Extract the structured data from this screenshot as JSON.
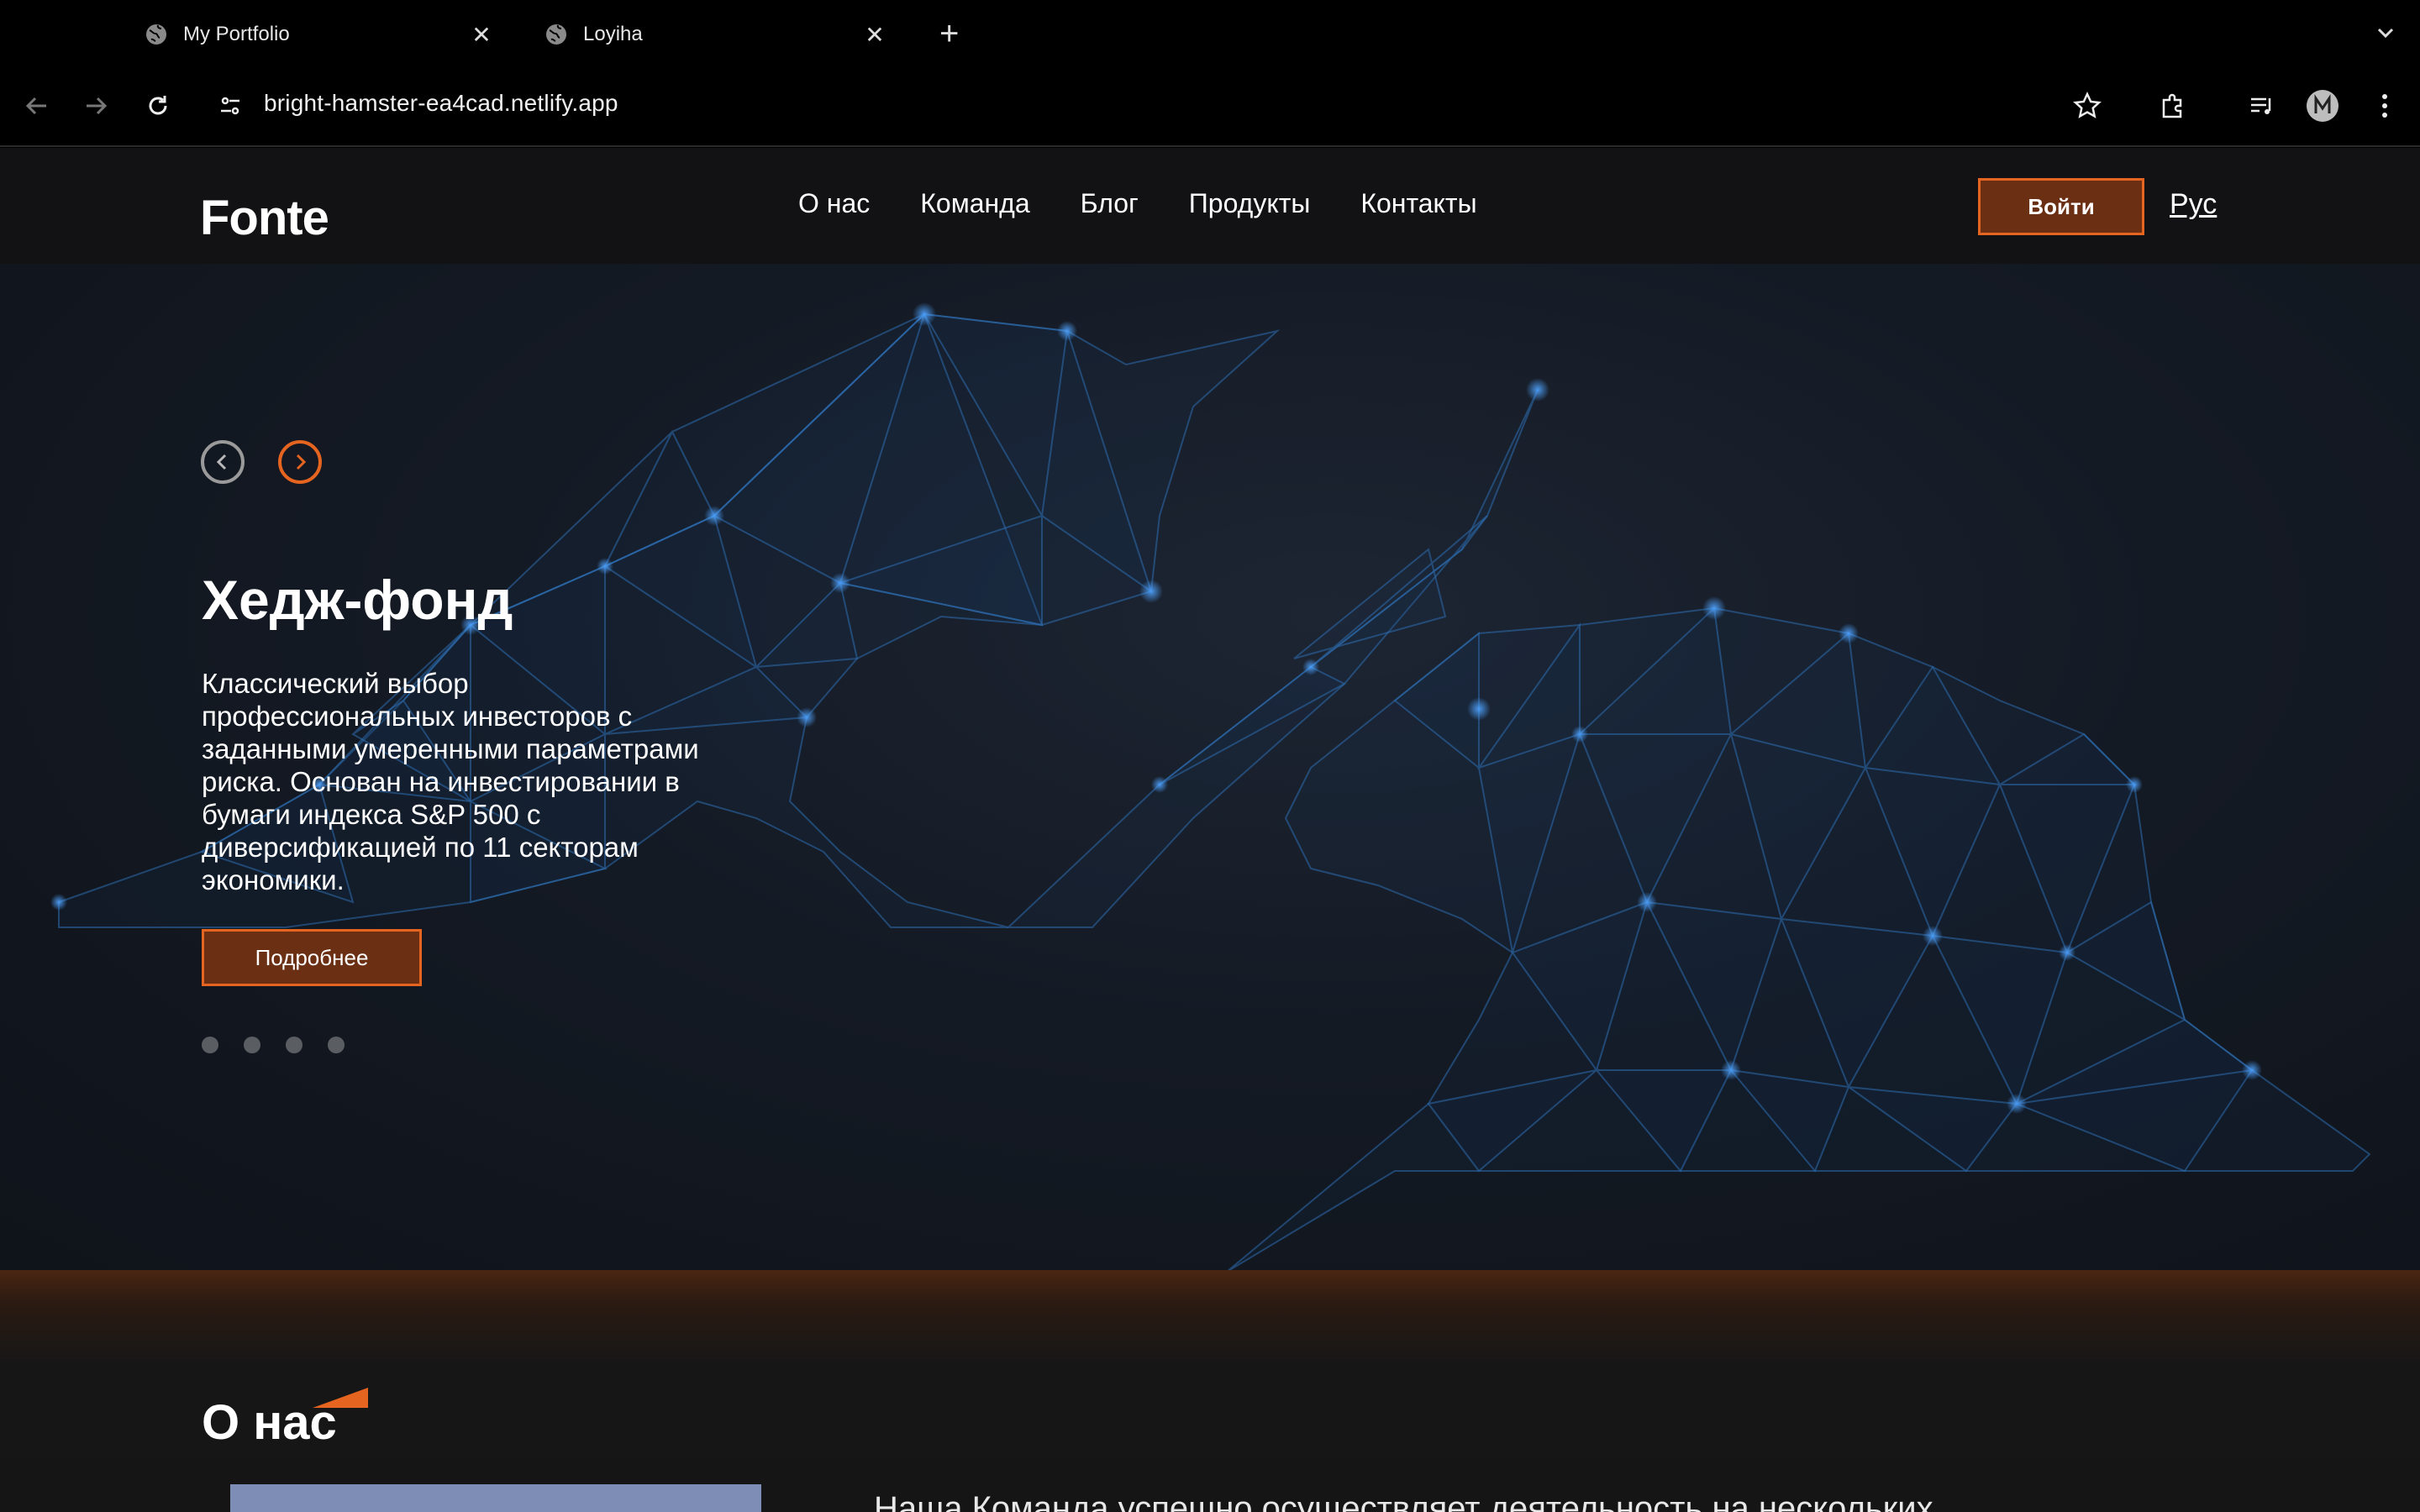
{
  "browser": {
    "tabs": [
      {
        "title": "My Portfolio"
      },
      {
        "title": "Loyiha"
      }
    ],
    "url": "bright-hamster-ea4cad.netlify.app"
  },
  "header": {
    "logo_text": "Fonte",
    "nav": [
      "О нас",
      "Команда",
      "Блог",
      "Продукты",
      "Контакты"
    ],
    "login_label": "Войти",
    "language": "Рус"
  },
  "hero": {
    "title": "Хедж-фонд",
    "description": "Классический выбор профессиональных инвесторов с заданными умеренными параметрами риска. Основан на инвестировании в бумаги индекса S&P 500 с диверсификацией по 11 секторам экономики.",
    "more_label": "Подробнее",
    "slide_count": 4
  },
  "about": {
    "title": "О нас",
    "text": "Наша Команда успешно осуществляет деятельность на нескольких"
  },
  "colors": {
    "accent": "#e5641f",
    "button_fill": "#6b2f13",
    "header_bg": "#121214",
    "hero_bg": "#141a24",
    "network_lines": "#2d6db0"
  }
}
